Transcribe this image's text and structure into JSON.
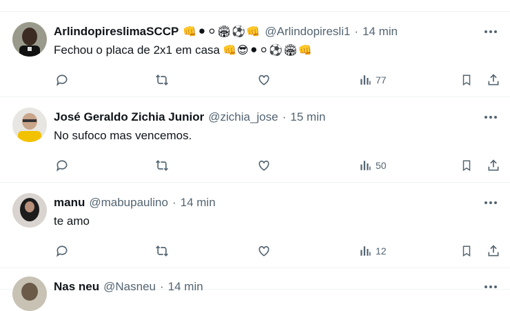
{
  "tweets": [
    {
      "name": "ArlindopireslimaSCCP",
      "name_emojis": "👊⚫⚪🏟⚽👊",
      "handle": "@Arlindopiresli1",
      "time": "14 min",
      "text": "Fechou o placa de 2x1 em casa",
      "text_emojis": "👊😎⚫⚪⚽🏟👊",
      "views": "77"
    },
    {
      "name": "José Geraldo Zichia Junior",
      "name_emojis": "",
      "handle": "@zichia_jose",
      "time": "15 min",
      "text": "No sufoco mas vencemos.",
      "text_emojis": "",
      "views": "50"
    },
    {
      "name": "manu",
      "name_emojis": "",
      "handle": "@mabupaulino",
      "time": "14 min",
      "text": "te amo",
      "text_emojis": "",
      "views": "12"
    },
    {
      "name": "Nas neu",
      "handle": "@Nasneu",
      "time": "14 min"
    }
  ],
  "separator": "·",
  "icons": [
    "reply-icon",
    "retweet-icon",
    "like-icon",
    "views-icon",
    "bookmark-icon",
    "share-icon",
    "more-icon"
  ],
  "colors": {
    "text": "#0f1419",
    "muted": "#536471",
    "border": "#eff3f4"
  }
}
